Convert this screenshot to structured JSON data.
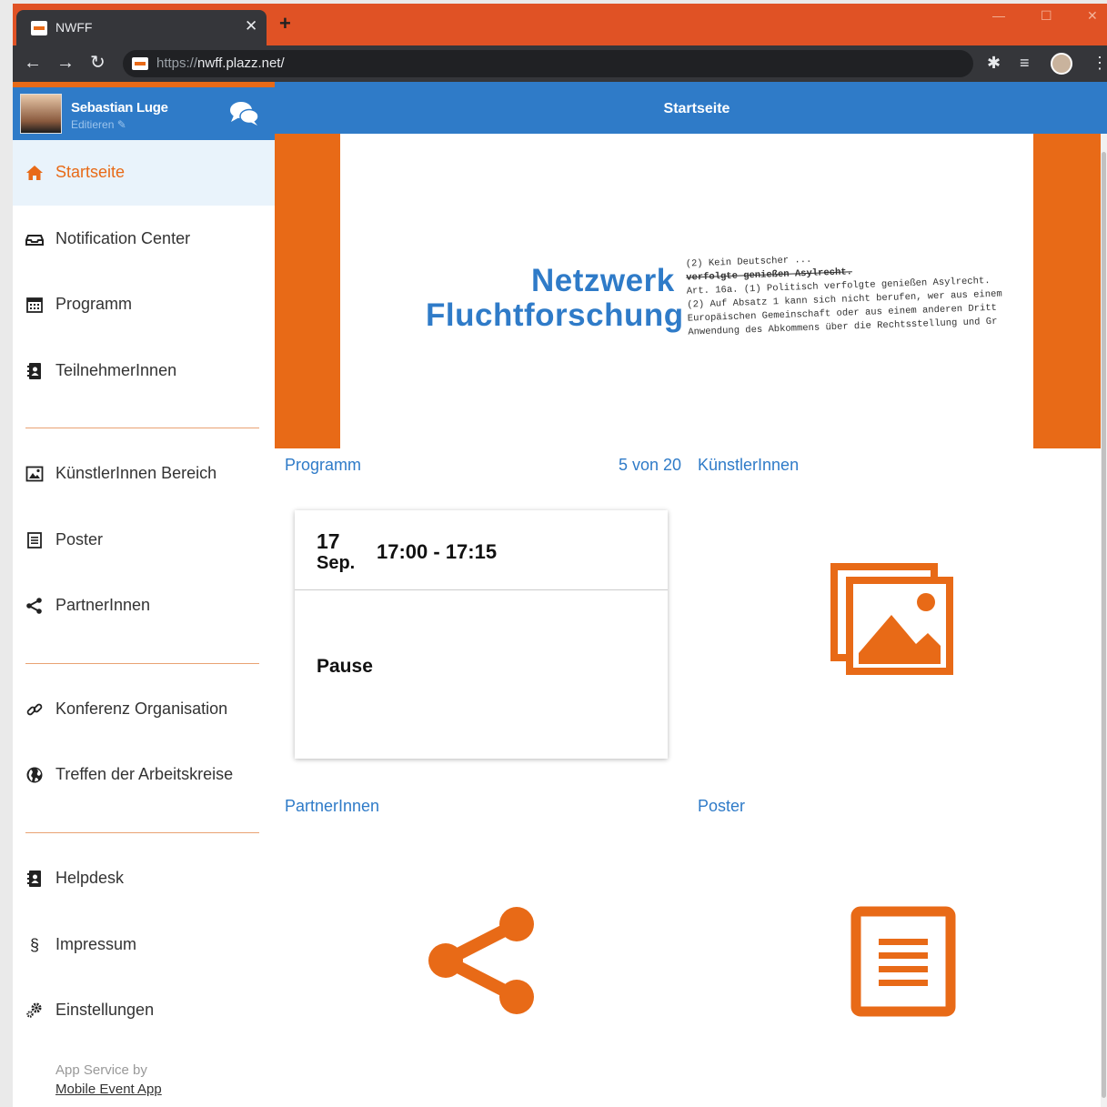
{
  "browser": {
    "tab_title": "NWFF",
    "tab_close": "✕",
    "new_tab": "+",
    "url_scheme": "https://",
    "url_host": "nwff.plazz.net/",
    "favicon_label": "NWFF"
  },
  "user": {
    "name": "Sebastian Luge",
    "edit_label": "Editieren"
  },
  "sidebar": {
    "items": [
      {
        "label": "Startseite",
        "icon": "home-icon",
        "active": true
      },
      {
        "label": "Notification Center",
        "icon": "inbox-icon"
      },
      {
        "label": "Programm",
        "icon": "calendar-icon"
      },
      {
        "label": "TeilnehmerInnen",
        "icon": "address-book-icon"
      },
      {
        "label": "KünstlerInnen Bereich",
        "icon": "image-icon"
      },
      {
        "label": "Poster",
        "icon": "document-icon"
      },
      {
        "label": "PartnerInnen",
        "icon": "share-icon"
      },
      {
        "label": "Konferenz Organisation",
        "icon": "link-icon"
      },
      {
        "label": "Treffen der Arbeitskreise",
        "icon": "globe-icon"
      },
      {
        "label": "Helpdesk",
        "icon": "address-book-icon"
      },
      {
        "label": "Impressum",
        "icon": "paragraph-icon"
      },
      {
        "label": "Einstellungen",
        "icon": "gears-icon"
      }
    ],
    "service_text": "App Service by",
    "service_link": "Mobile Event App"
  },
  "main": {
    "title": "Startseite",
    "banner": {
      "line1": "Netzwerk",
      "line2": "Fluchtforschung",
      "doc_lines": [
        "(2) Kein Deutscher ...",
        "verfolgte genießen Asylrecht.",
        "Art. 16a. (1) Politisch verfolgte genießen Asylrecht.",
        "(2) Auf Absatz 1 kann sich nicht berufen, wer aus einem",
        "Europäischen Gemeinschaft oder aus einem anderen Dritt",
        "Anwendung des Abkommens über die Rechtsstellung und Gr"
      ]
    },
    "programm": {
      "title": "Programm",
      "counter": "5 von 20",
      "card": {
        "day": "17",
        "month": "Sep.",
        "time": "17:00 - 17:15",
        "title": "Pause"
      }
    },
    "kuenstler_title": "KünstlerInnen",
    "partner_title": "PartnerInnen",
    "poster_title": "Poster"
  },
  "colors": {
    "brand_orange": "#e86a17",
    "brand_blue": "#2f7bc8",
    "tab_orange": "#e05225"
  }
}
